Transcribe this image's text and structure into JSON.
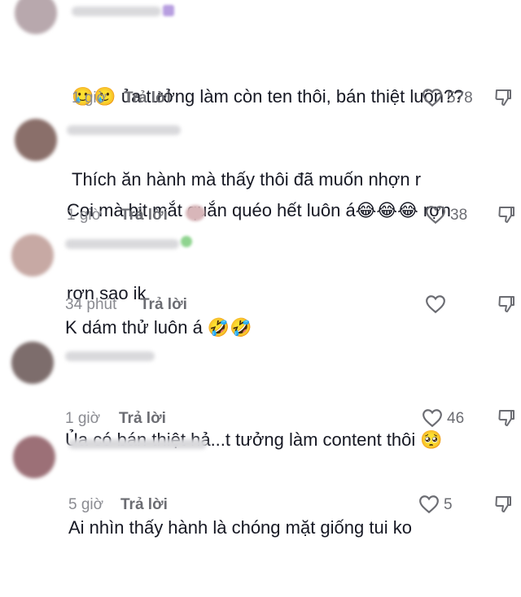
{
  "comments": [
    {
      "text_line1": "🥲🥲 ủa tưởng làm còn ten thôi, bán thiệt luôn??",
      "text_line2": "Thích ăn hành mà thấy thôi đã muốn nhợn r",
      "time": "1 giờ",
      "reply_label": "Trả lời",
      "likes": "578",
      "avatar_color": "#b8a8ad"
    },
    {
      "text_line1": "Coi mà bịt mắt quắn quéo hết luôn á😂😂😂 rợn",
      "text_line2": "rợn sao ik",
      "time": "1 giờ",
      "reply_label": "Trả lời",
      "likes": "38",
      "avatar_color": "#8a6f6a"
    },
    {
      "text_line1": "K dám thử luôn á 🤣🤣",
      "time": "34 phút",
      "reply_label": "Trả lời",
      "likes": "",
      "avatar_color": "#c7a9a4"
    },
    {
      "text_line1": "Ủa có bán thiệt hả...t tưởng làm content thôi 🥺",
      "time": "1 giờ",
      "reply_label": "Trả lời",
      "likes": "46",
      "avatar_color": "#7d6d6c"
    },
    {
      "text_line1": "Ai nhìn thấy hành là chóng mặt giống tui ko",
      "time": "5 giờ",
      "reply_label": "Trả lời",
      "likes": "5",
      "avatar_color": "#9c7077"
    }
  ]
}
